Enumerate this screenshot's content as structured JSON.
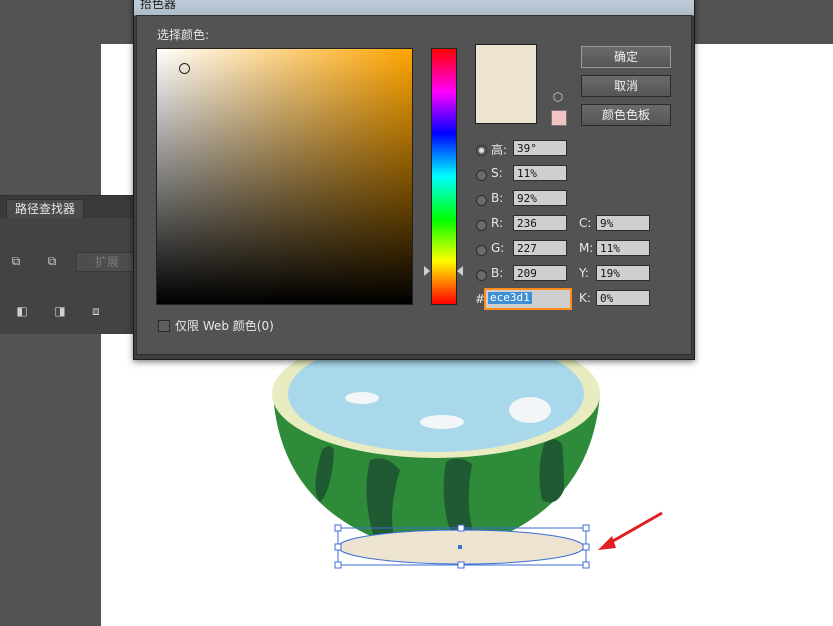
{
  "dialog": {
    "title": "拾色器",
    "select_label": "选择颜色:",
    "buttons": {
      "ok": "确定",
      "cancel": "取消",
      "swatches": "颜色色板"
    },
    "hsb": [
      {
        "label": "高:",
        "value": "39°"
      },
      {
        "label": "S:",
        "value": "11%"
      },
      {
        "label": "B:",
        "value": "92%"
      }
    ],
    "rgb": [
      {
        "label": "R:",
        "value": "236"
      },
      {
        "label": "G:",
        "value": "227"
      },
      {
        "label": "B:",
        "value": "209"
      }
    ],
    "cmyk": [
      {
        "label": "C:",
        "value": "9%"
      },
      {
        "label": "M:",
        "value": "11%"
      },
      {
        "label": "Y:",
        "value": "19%"
      },
      {
        "label": "K:",
        "value": "0%"
      }
    ],
    "hex_label": "#",
    "hex_value": "ece3d1",
    "web_only_label": "仅限 Web 颜色(0)",
    "current_color": "#ece3d1",
    "gamut_warning_color": "#f2c4c4"
  },
  "pathfinder": {
    "tab_label": "路径查找器",
    "expand_label": "扩展"
  },
  "colors": {
    "workspace": "#535353",
    "artboard": "#ffffff",
    "melon_green": "#2e8b3a",
    "melon_stripe": "#1f5a32",
    "rind": "#e8ecc0",
    "flesh_edge": "#b0202a",
    "water": "#a8d8ea",
    "shadow_fill": "#ece3d1",
    "selection": "#3b6fd6",
    "arrow": "#e02020"
  }
}
